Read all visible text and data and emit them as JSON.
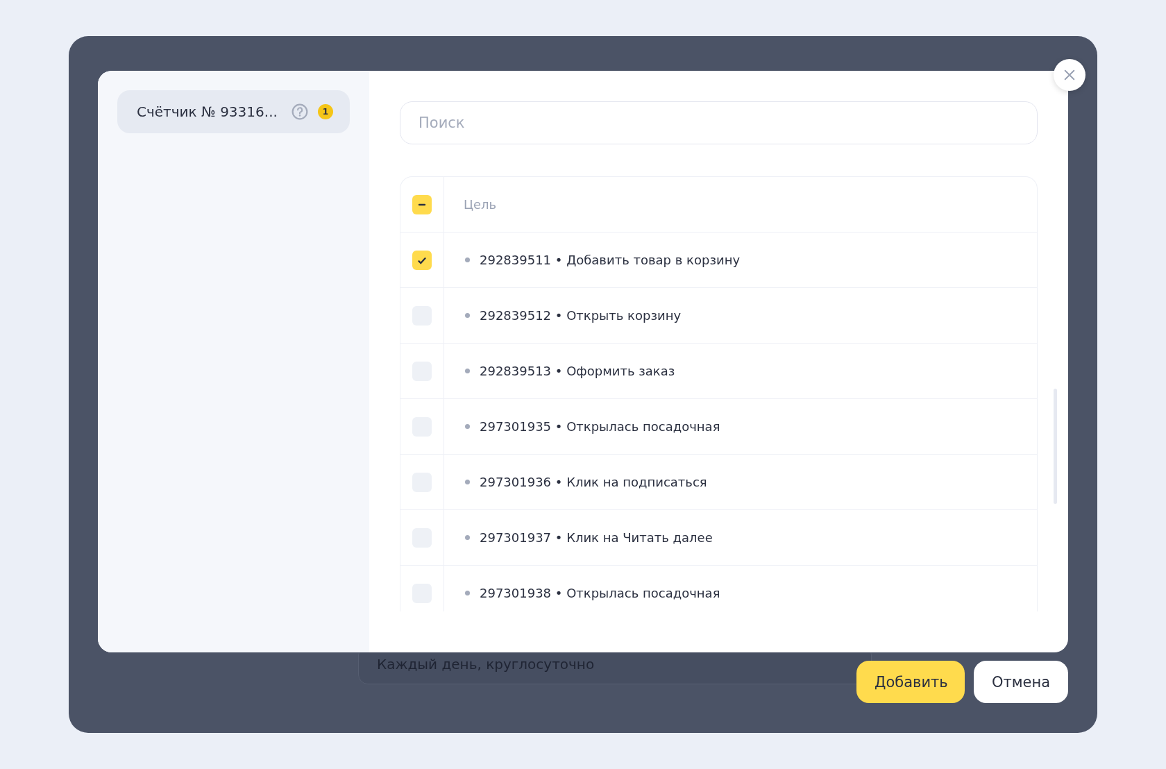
{
  "background": {
    "schedule_field": {
      "value": "Каждый день, круглосуточно"
    }
  },
  "modal": {
    "sidebar": {
      "items": [
        {
          "label": "Счётчик № 93316...",
          "badge": "1",
          "selected": true
        }
      ]
    },
    "search": {
      "placeholder": "Поиск"
    },
    "table": {
      "header": {
        "label": "Цель",
        "partial": true
      },
      "rows": [
        {
          "text": "292839511 • Добавить товар в корзину",
          "checked": true
        },
        {
          "text": "292839512 • Открыть корзину",
          "checked": false
        },
        {
          "text": "292839513 • Оформить заказ",
          "checked": false
        },
        {
          "text": "297301935 • Открылась посадочная",
          "checked": false
        },
        {
          "text": "297301936 • Клик на подписаться",
          "checked": false
        },
        {
          "text": "297301937 • Клик на Читать далее",
          "checked": false
        },
        {
          "text": "297301938 • Открылась посадочная",
          "checked": false
        }
      ]
    }
  },
  "buttons": [
    {
      "label": "Добавить",
      "kind": "primary"
    },
    {
      "label": "Отмена",
      "kind": "secondary"
    }
  ]
}
